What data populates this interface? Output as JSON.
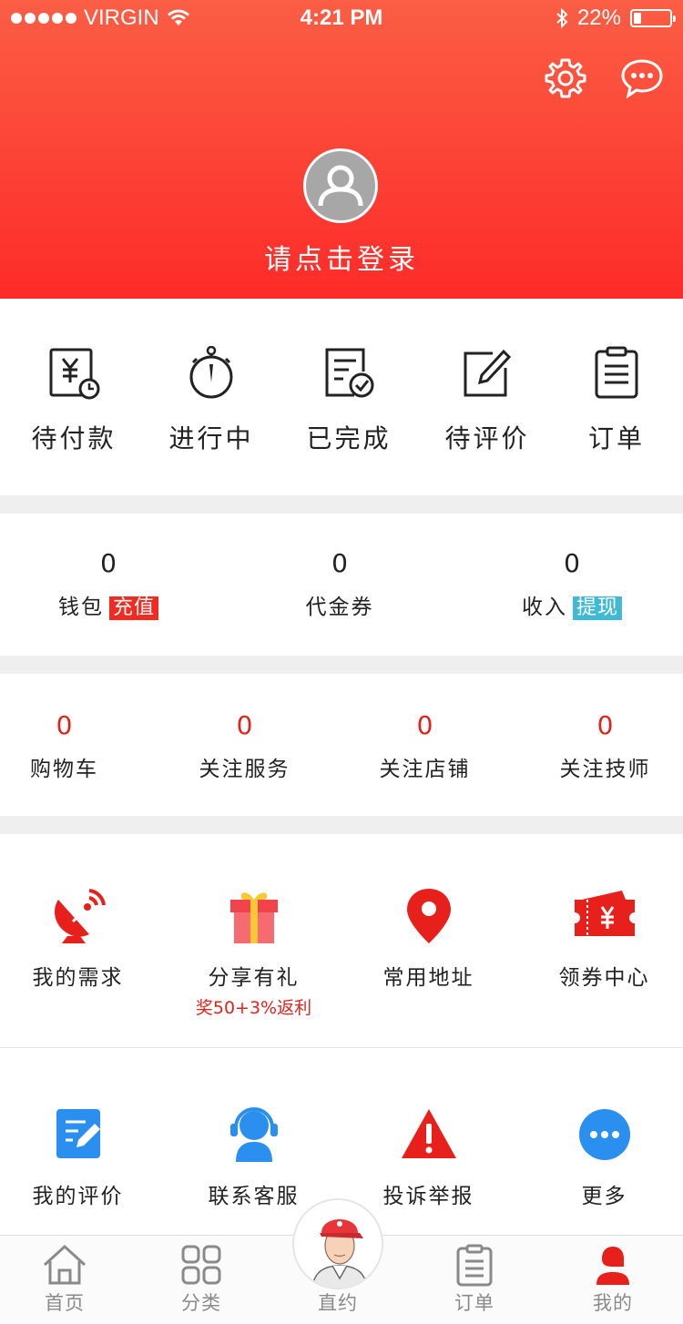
{
  "status": {
    "carrier": "VIRGIN",
    "time": "4:21 PM",
    "battery": "22%",
    "battery_level": 0.22
  },
  "header": {
    "login_prompt": "请点击登录"
  },
  "orders": [
    {
      "label": "待付款",
      "icon": "payment-pending-icon"
    },
    {
      "label": "进行中",
      "icon": "stopwatch-icon"
    },
    {
      "label": "已完成",
      "icon": "completed-doc-icon"
    },
    {
      "label": "待评价",
      "icon": "edit-review-icon"
    },
    {
      "label": "订单",
      "icon": "clipboard-icon"
    }
  ],
  "wallet": [
    {
      "value": "0",
      "label": "钱包",
      "tag": "充值"
    },
    {
      "value": "0",
      "label": "代金券",
      "tag": ""
    },
    {
      "value": "0",
      "label": "收入",
      "tag": "提现"
    }
  ],
  "favorites": [
    {
      "value": "0",
      "label": "购物车"
    },
    {
      "value": "0",
      "label": "关注服务"
    },
    {
      "value": "0",
      "label": "关注店铺"
    },
    {
      "value": "0",
      "label": "关注技师"
    }
  ],
  "services_row1": [
    {
      "label": "我的需求",
      "icon": "satellite-dish-icon",
      "sub": ""
    },
    {
      "label": "分享有礼",
      "icon": "gift-icon",
      "sub": "奖50+3%返利"
    },
    {
      "label": "常用地址",
      "icon": "location-pin-icon",
      "sub": ""
    },
    {
      "label": "领券中心",
      "icon": "coupon-icon",
      "sub": ""
    }
  ],
  "services_row2": [
    {
      "label": "我的评价",
      "icon": "review-note-icon"
    },
    {
      "label": "联系客服",
      "icon": "customer-service-icon"
    },
    {
      "label": "投诉举报",
      "icon": "warning-icon"
    },
    {
      "label": "更多",
      "icon": "more-icon"
    }
  ],
  "tabs": [
    {
      "label": "首页",
      "icon": "home-icon"
    },
    {
      "label": "分类",
      "icon": "grid-icon"
    },
    {
      "label": "直约",
      "icon": "technician-avatar"
    },
    {
      "label": "订单",
      "icon": "order-list-icon"
    },
    {
      "label": "我的",
      "icon": "profile-icon"
    }
  ],
  "colors": {
    "brand_red": "#f12b22",
    "header_top": "#fb5e44",
    "header_bottom": "#fd2b29",
    "withdraw_blue": "#3fb9d6",
    "service_blue": "#2b8ff0"
  }
}
